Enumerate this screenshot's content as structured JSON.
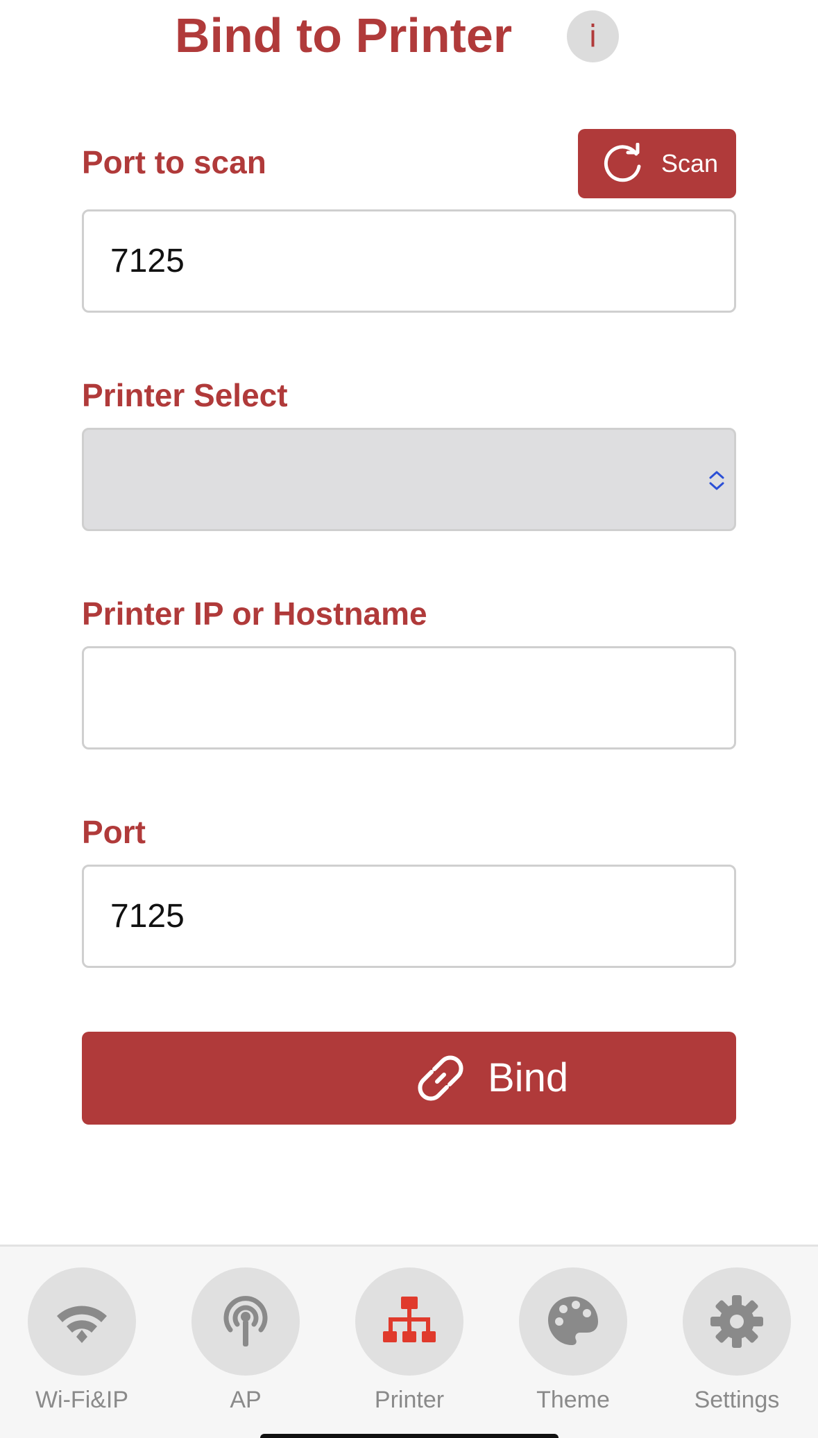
{
  "header": {
    "title": "Bind to Printer",
    "info_label": "i"
  },
  "form": {
    "port_to_scan": {
      "label": "Port to scan",
      "value": "7125"
    },
    "scan_button": {
      "label": "Scan",
      "icon": "refresh-icon"
    },
    "printer_select": {
      "label": "Printer Select",
      "value": ""
    },
    "printer_host": {
      "label": "Printer IP or Hostname",
      "value": ""
    },
    "port": {
      "label": "Port",
      "value": "7125"
    },
    "bind_button": {
      "label": "Bind",
      "icon": "link-icon"
    }
  },
  "tabbar": {
    "active": "Printer",
    "tabs": [
      {
        "label": "Wi-Fi&IP",
        "icon": "wifi-icon"
      },
      {
        "label": "AP",
        "icon": "antenna-icon"
      },
      {
        "label": "Printer",
        "icon": "network-icon"
      },
      {
        "label": "Theme",
        "icon": "palette-icon"
      },
      {
        "label": "Settings",
        "icon": "gear-icon"
      }
    ]
  },
  "colors": {
    "accent": "#b03a3a",
    "inactive_icon": "#8a8a8a",
    "active_icon": "#e03a2c",
    "tab_circle": "#e0e0e0"
  }
}
